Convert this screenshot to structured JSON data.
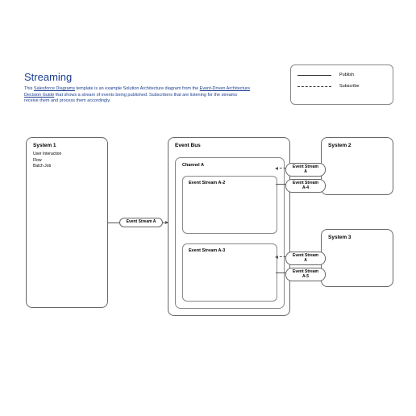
{
  "title": "Streaming",
  "description_parts": {
    "pre": "This ",
    "link1": "Salesforce Diagrams",
    "mid": " template is an example Solution Architecture diagram from the ",
    "link2": "Event-Driven Architecture Decision Guide",
    "post": " that shows a stream of events being published. Subscribers that are listening for the streams receive them and process them accordingly."
  },
  "legend": {
    "publish": "Publish",
    "subscribe": "Subscribe"
  },
  "system1": {
    "title": "System 1",
    "items": [
      "User Interaction",
      "Flow",
      "Batch Job"
    ]
  },
  "eventbus": {
    "title": "Event Bus"
  },
  "channel": {
    "title": "Channel A"
  },
  "stream_a2": {
    "title": "Event Stream A-2"
  },
  "stream_a3": {
    "title": "Event Stream A-3"
  },
  "system2": {
    "title": "System 2"
  },
  "system3": {
    "title": "System 3"
  },
  "pills": {
    "a": "Event Stream A",
    "a_sub1": "Event Stream A",
    "a4": "Event Stream A-4",
    "a_sub2": "Event Stream A",
    "a5": "Event Stream A-5"
  }
}
